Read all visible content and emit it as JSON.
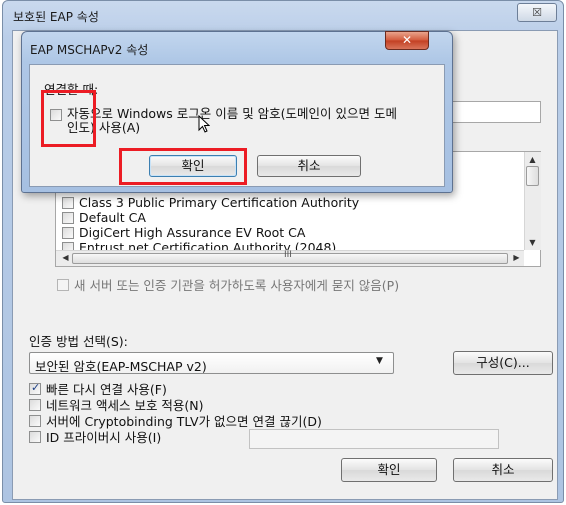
{
  "outer_dialog": {
    "title": "보호된 EAP 속성",
    "close_glyph": "☒",
    "certificates": [
      {
        "label": "Class 3 Public Primary Certification Authority",
        "checked": false
      },
      {
        "label": "Default CA",
        "checked": false
      },
      {
        "label": "DigiCert High Assurance EV Root CA",
        "checked": false
      },
      {
        "label": "Entrust.net Certification Authority (2048)",
        "checked": false
      }
    ],
    "scroll_grip": "III",
    "no_prompt_label": "새 서버 또는 인증 기관을 허가하도록 사용자에게 묻지 않음(P)",
    "auth_method_label": "인증 방법 선택(S):",
    "auth_method_value": "보안된 암호(EAP-MSCHAP v2)",
    "config_button": "구성(C)...",
    "options": [
      {
        "label": "빠른 다시 연결 사용(F)",
        "checked": true
      },
      {
        "label": "네트워크 액세스 보호 적용(N)",
        "checked": false
      },
      {
        "label": "서버에 Cryptobinding TLV가 없으면 연결 끊기(D)",
        "checked": false
      },
      {
        "label": "ID 프라이버시 사용(I)",
        "checked": false
      }
    ],
    "ok_button": "확인",
    "cancel_button": "취소"
  },
  "inner_dialog": {
    "title": "EAP MSCHAPv2 속성",
    "close_glyph": "✕",
    "connect_label": "연결할 때:",
    "autologon_label": "자동으로 Windows 로그온 이름 및 암호(도메인이 있으면 도메인도) 사용(A)",
    "autologon_checked": false,
    "ok_button": "확인",
    "cancel_button": "취소"
  },
  "colors": {
    "highlight": "#ec1c24",
    "close_button": "#c23f22",
    "window_frame": "#b9cde8"
  }
}
